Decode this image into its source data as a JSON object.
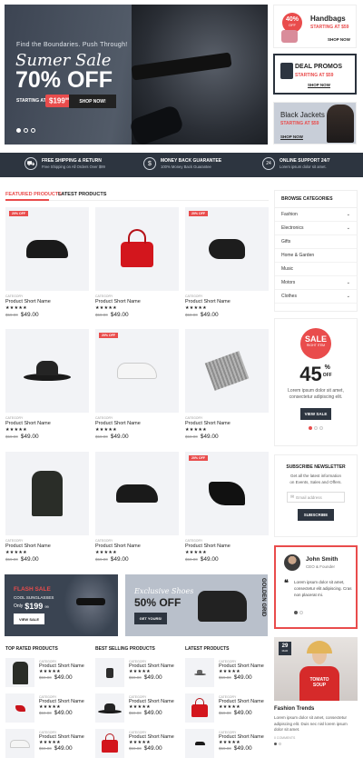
{
  "hero": {
    "subtitle": "Find the Boundaries. Push Through!",
    "title_script": "Sumer Sale",
    "title_big": "70% OFF",
    "starting_label": "STARTING AT",
    "price": "$199",
    "price_cents": "99",
    "button": "SHOP NOW!"
  },
  "side_banners": [
    {
      "badge_pct": "40%",
      "badge_off": "OFF",
      "title": "Handbags",
      "sub": "STARTING AT $59",
      "shop": "SHOP NOW"
    },
    {
      "title": "DEAL PROMOS",
      "sub": "STARTING AT $59",
      "shop": "SHOP NOW"
    },
    {
      "title": "Black Jackets",
      "sub": "STARTING AT $59",
      "shop": "SHOP NOW"
    }
  ],
  "features": [
    {
      "icon": "truck-icon",
      "glyph": "⛟",
      "title": "FREE SHIPPING & RETURN",
      "text": "Free Shipping on All Orders Over $99"
    },
    {
      "icon": "money-icon",
      "glyph": "$",
      "title": "MONEY BACK GUARANTEE",
      "text": "100% Money Back Guarantee"
    },
    {
      "icon": "support-icon",
      "glyph": "24",
      "title": "ONLINE SUPPORT 24/7",
      "text": "Lorem ipsum dolor sit amet."
    }
  ],
  "tabs": {
    "featured": "FEATURED PRODUCTS",
    "latest": "LATEST PRODUCTS"
  },
  "products": [
    {
      "badge": "20% OFF",
      "cat": "CATEGORY",
      "name": "Product Short Name",
      "stars": "★★★★★",
      "old": "$59.00",
      "price": "$49.00",
      "kind": "shoes"
    },
    {
      "badge": "",
      "cat": "CATEGORY",
      "name": "Product Short Name",
      "stars": "★★★★★",
      "old": "$59.00",
      "price": "$49.00",
      "kind": "bag"
    },
    {
      "badge": "20% OFF",
      "cat": "CATEGORY",
      "name": "Product Short Name",
      "stars": "★★★★★",
      "old": "$59.00",
      "price": "$49.00",
      "kind": "cap"
    },
    {
      "badge": "",
      "cat": "CATEGORY",
      "name": "Product Short Name",
      "stars": "★★★★★",
      "old": "$59.00",
      "price": "$49.00",
      "kind": "hat"
    },
    {
      "badge": "20% OFF",
      "cat": "CATEGORY",
      "name": "Product Short Name",
      "stars": "★★★★★",
      "old": "$59.00",
      "price": "$49.00",
      "kind": "sneaker"
    },
    {
      "badge": "",
      "cat": "CATEGORY",
      "name": "Product Short Name",
      "stars": "★★★★★",
      "old": "$59.00",
      "price": "$49.00",
      "kind": "scarf"
    },
    {
      "badge": "",
      "cat": "CATEGORY",
      "name": "Product Short Name",
      "stars": "★★★★★",
      "old": "$59.00",
      "price": "$49.00",
      "kind": "coat"
    },
    {
      "badge": "",
      "cat": "CATEGORY",
      "name": "Product Short Name",
      "stars": "★★★★★",
      "old": "$59.00",
      "price": "$49.00",
      "kind": "shoes"
    },
    {
      "badge": "20% OFF",
      "cat": "CATEGORY",
      "name": "Product Short Name",
      "stars": "★★★★★",
      "old": "$59.00",
      "price": "$49.00",
      "kind": "heels"
    }
  ],
  "categories": {
    "title": "BROWSE CATEGORIES",
    "items": [
      {
        "label": "Fashion",
        "arrow": "⌄"
      },
      {
        "label": "Electronics",
        "arrow": "⌄"
      },
      {
        "label": "Gifts",
        "arrow": ""
      },
      {
        "label": "Home & Garden",
        "arrow": ""
      },
      {
        "label": "Music",
        "arrow": ""
      },
      {
        "label": "Motors",
        "arrow": "⌄"
      },
      {
        "label": "Clothes",
        "arrow": "⌄"
      }
    ]
  },
  "sale_widget": {
    "sale": "SALE",
    "sub": "RIGHT ITEM",
    "pct": "45",
    "pct_sign": "%",
    "off": "OFF",
    "text": "Lorem ipsum dolor sit amet, consectetur adipiscing elit.",
    "button": "VIEW SALE"
  },
  "newsletter": {
    "title": "SUBSCRIBE NEWSLETTER",
    "text": "Get all the latest information on Events, Sales and Offers.",
    "placeholder": "Email address",
    "button": "SUBSCRIBE"
  },
  "testimonial": {
    "name": "John Smith",
    "role": "CEO & Founder",
    "quote": "Lorem ipsum dolor sit amet, consectetur elit adipiscing. Cras non placerat mi."
  },
  "promo1": {
    "tag": "FLASH SALE",
    "sub": "COOL SUNGLASSES",
    "only": "Only",
    "price": "$199",
    "cents": "99",
    "button": "VIEW SALE"
  },
  "promo2": {
    "script": "Exclusive Shoes",
    "big": "50% OFF",
    "button": "GET YOURS!",
    "vertical": "GOLDEN GRID"
  },
  "columns": [
    {
      "title": "TOP RATED PRODUCTS",
      "items": [
        {
          "cat": "CATEGORY",
          "name": "Product Short Name",
          "stars": "★★★★★",
          "old": "$59.00",
          "price": "$49.00",
          "kind": "coat"
        },
        {
          "cat": "CATEGORY",
          "name": "Product Short Name",
          "stars": "★★★★★",
          "old": "$59.00",
          "price": "$49.00",
          "kind": "heels-red"
        },
        {
          "cat": "CATEGORY",
          "name": "Product Short Name",
          "stars": "★★★★★",
          "old": "$59.00",
          "price": "$49.00",
          "kind": "sneaker"
        }
      ]
    },
    {
      "title": "BEST SELLING PRODUCTS",
      "items": [
        {
          "cat": "CATEGORY",
          "name": "Product Short Name",
          "stars": "★★★★★",
          "old": "$59.00",
          "price": "$49.00",
          "kind": "watch"
        },
        {
          "cat": "CATEGORY",
          "name": "Product Short Name",
          "stars": "★★★★★",
          "old": "$59.00",
          "price": "$49.00",
          "kind": "hat"
        },
        {
          "cat": "CATEGORY",
          "name": "Product Short Name",
          "stars": "★★★★★",
          "old": "$59.00",
          "price": "$49.00",
          "kind": "bag"
        }
      ]
    },
    {
      "title": "LATEST PRODUCTS",
      "items": [
        {
          "cat": "CATEGORY",
          "name": "Product Short Name",
          "stars": "★★★★★",
          "old": "$59.00",
          "price": "$49.00",
          "kind": "hat2"
        },
        {
          "cat": "CATEGORY",
          "name": "Product Short Name",
          "stars": "★★★★★",
          "old": "$59.00",
          "price": "$49.00",
          "kind": "bag"
        },
        {
          "cat": "CATEGORY",
          "name": "Product Short Name",
          "stars": "★★★★★",
          "old": "$59.00",
          "price": "$49.00",
          "kind": "loafer"
        }
      ]
    }
  ],
  "blog": {
    "day": "29",
    "month": "MAR",
    "shirt1": "TOMATO",
    "shirt2": "SOUP",
    "title": "Fashion Trends",
    "text": "Lorem ipsum dolor sit amet, consectetur adipiscing elit. Duis nec nisl lorem ipsum dolor sit amet.",
    "comments": "0 COMMENTS"
  },
  "colors": {
    "accent": "#e94c4c",
    "dark": "#2d3540"
  }
}
